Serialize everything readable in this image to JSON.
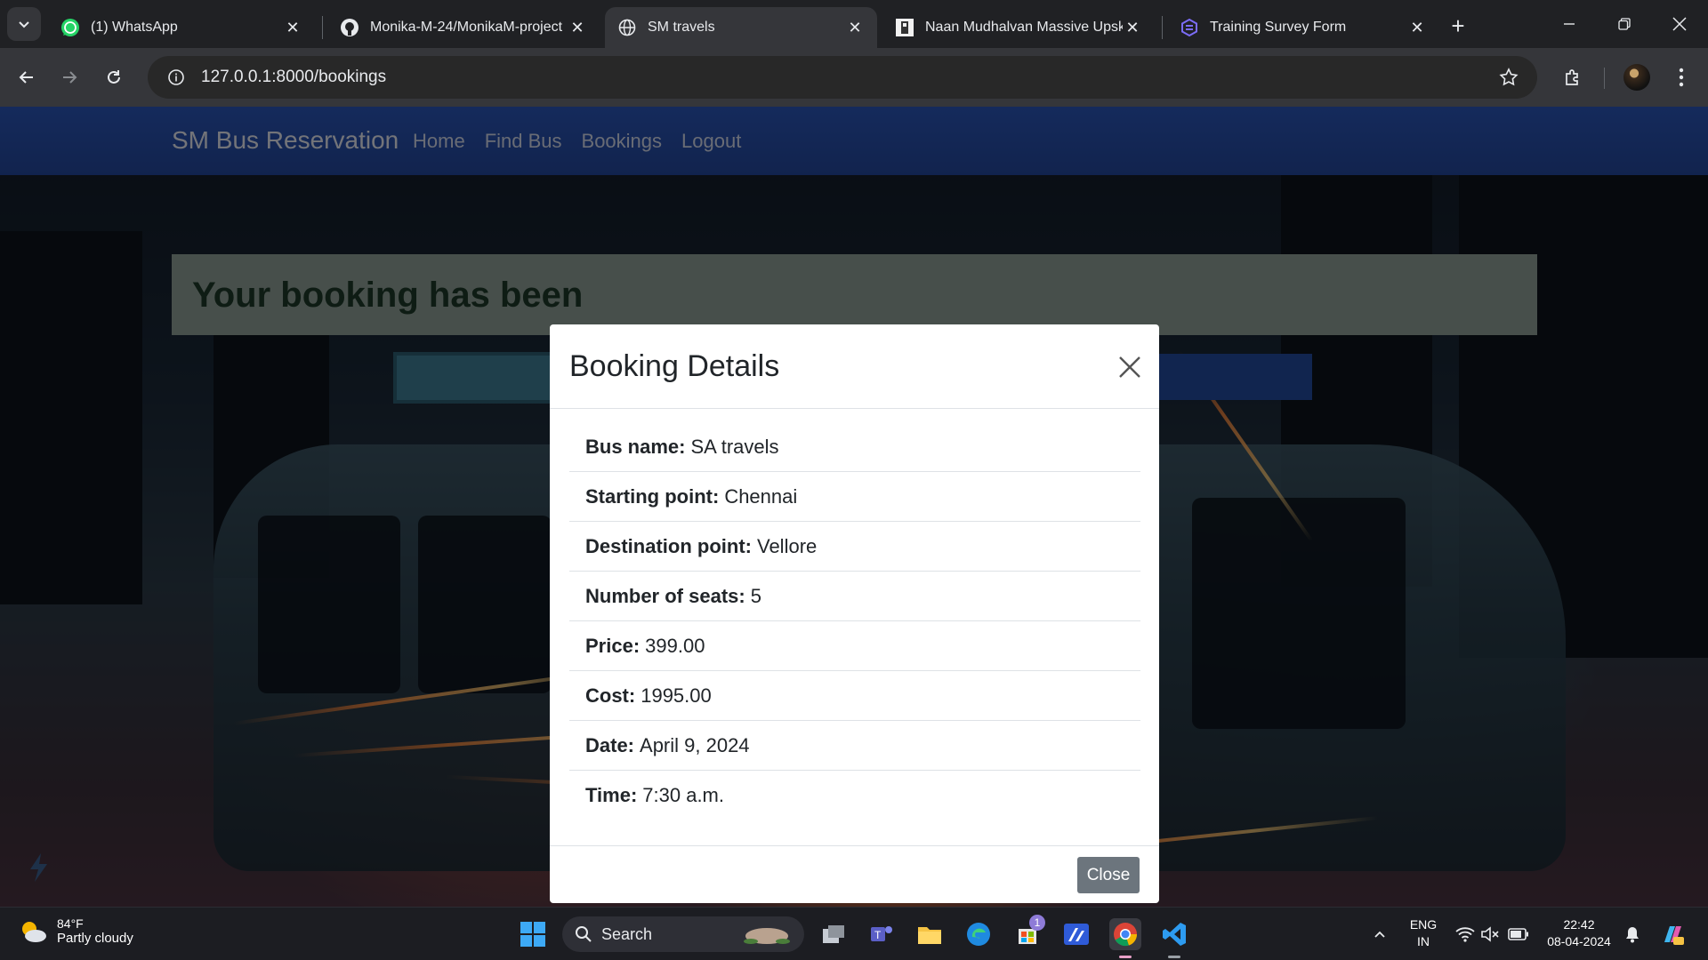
{
  "browser": {
    "tabs": [
      {
        "title": "(1) WhatsApp",
        "icon": "whatsapp-icon"
      },
      {
        "title": "Monika-M-24/MonikaM-project",
        "icon": "github-icon"
      },
      {
        "title": "SM travels",
        "icon": "globe-icon",
        "active": true
      },
      {
        "title": "Naan Mudhalvan Massive Upski",
        "icon": "naan-mudhalvan-icon"
      },
      {
        "title": "Training Survey Form",
        "icon": "survey-form-icon"
      }
    ],
    "url": "127.0.0.1:8000/bookings"
  },
  "site": {
    "brand": "SM Bus Reservation",
    "nav": [
      "Home",
      "Find Bus",
      "Bookings",
      "Logout"
    ],
    "alert_text": "Your booking has been"
  },
  "modal": {
    "title": "Booking Details",
    "close_label": "Close",
    "details": [
      {
        "label": "Bus name:",
        "value": "SA travels"
      },
      {
        "label": "Starting point:",
        "value": "Chennai"
      },
      {
        "label": "Destination point:",
        "value": "Vellore"
      },
      {
        "label": "Number of seats:",
        "value": "5"
      },
      {
        "label": "Price:",
        "value": "399.00"
      },
      {
        "label": "Cost:",
        "value": "1995.00"
      },
      {
        "label": "Date:",
        "value": "April 9, 2024"
      },
      {
        "label": "Time:",
        "value": "7:30 a.m."
      }
    ]
  },
  "taskbar": {
    "weather_temp": "84°F",
    "weather_desc": "Partly cloudy",
    "search_label": "Search",
    "lang_line1": "ENG",
    "lang_line2": "IN",
    "time": "22:42",
    "date": "08-04-2024",
    "store_badge": "1"
  },
  "colors": {
    "navbar": "#23479c",
    "alert_bg": "#8f9e97",
    "close_button": "#6c757d",
    "browser_bg": "#202124"
  }
}
